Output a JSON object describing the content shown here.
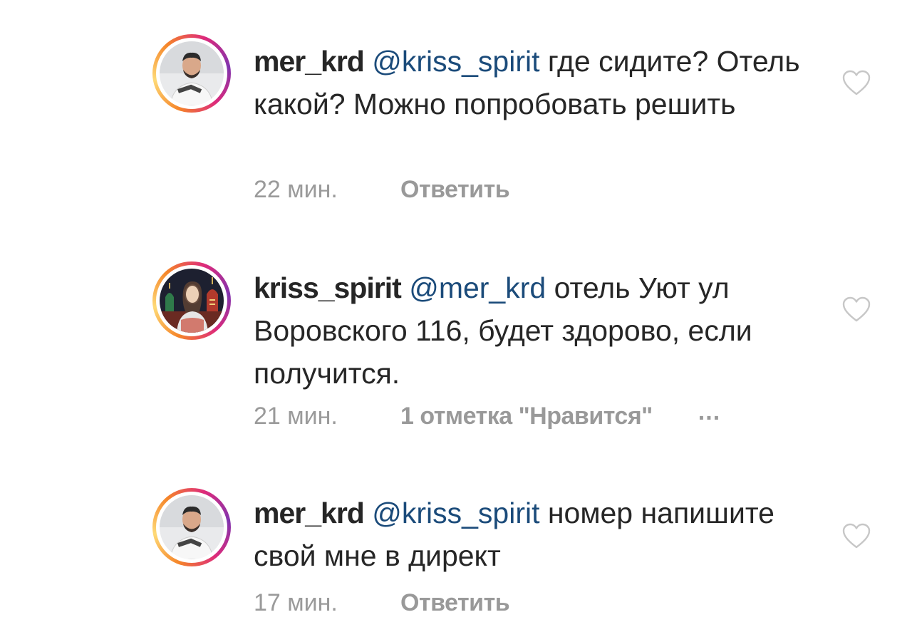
{
  "comments": [
    {
      "username": "mer_krd",
      "mention": "@kriss_spirit",
      "text": " где сидите? Отель какой? Можно попробовать решить",
      "time": "22 мин.",
      "action": "Ответить",
      "avatar": "avatar-man-in-white-shirt"
    },
    {
      "username": "kriss_spirit",
      "mention": "@mer_krd",
      "text": " отель Уют ул Воровского 116, будет здорово, если получится.",
      "time": "21 мин.",
      "action": "1 отметка \"Нравится\"",
      "more": "...",
      "avatar": "avatar-woman-at-st-basils-cathedral"
    },
    {
      "username": "mer_krd",
      "mention": "@kriss_spirit",
      "text": " номер напишите свой мне в директ",
      "time": "17 мин.",
      "action": "Ответить",
      "avatar": "avatar-man-in-white-shirt"
    }
  ],
  "icons": {
    "like": "heart-outline-icon"
  },
  "colors": {
    "mention": "#1b4b7a",
    "meta": "#8e8e8e",
    "text": "#262626"
  }
}
